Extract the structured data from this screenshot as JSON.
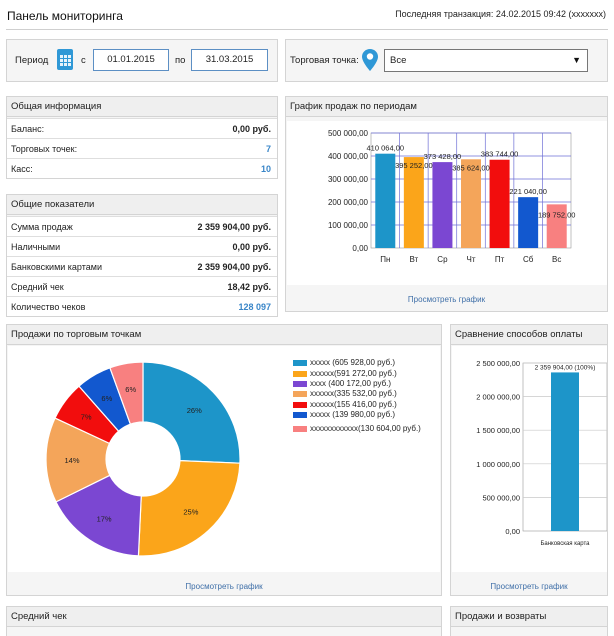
{
  "header": {
    "title": "Панель мониторинга",
    "last_transaction": "Последняя транзакция: 24.02.2015 09:42 (xxxxxxx)"
  },
  "filters": {
    "period_label": "Период",
    "from_label": "с",
    "from_value": "01.01.2015",
    "to_label": "по",
    "to_value": "31.03.2015",
    "store_label": "Торговая точка:",
    "store_value": "Все"
  },
  "general_info": {
    "title": "Общая информация",
    "rows": [
      {
        "label": "Баланс:",
        "value": "0,00 руб."
      },
      {
        "label": "Торговых точек:",
        "value": "7"
      },
      {
        "label": "Касс:",
        "value": "10"
      }
    ]
  },
  "general_metrics": {
    "title": "Общие показатели",
    "rows": [
      {
        "label": "Сумма продаж",
        "value": "2 359 904,00 руб."
      },
      {
        "label": "Наличными",
        "value": "0,00 руб."
      },
      {
        "label": "Банковскими картами",
        "value": "2 359 904,00 руб."
      },
      {
        "label": "Средний чек",
        "value": "18,42 руб."
      },
      {
        "label": "Количество чеков",
        "value": "128 097"
      }
    ]
  },
  "sales_by_period": {
    "title": "График продаж по периодам",
    "link": "Просмотреть график"
  },
  "sales_by_store": {
    "title": "Продажи по торговым точкам",
    "link": "Просмотреть график"
  },
  "payment_methods": {
    "title": "Сравнение способов оплаты",
    "link": "Просмотреть график"
  },
  "avg_check": {
    "title": "Средний чек"
  },
  "sales_returns": {
    "title": "Продажи и возвраты"
  },
  "chart_data": [
    {
      "type": "bar",
      "title": "",
      "categories": [
        "Пн",
        "Вт",
        "Ср",
        "Чт",
        "Пт",
        "Сб",
        "Вс"
      ],
      "values": [
        410064,
        395252,
        373428,
        385624,
        383744,
        221040,
        189752
      ],
      "labels": [
        "410 064,00",
        "395 252,00",
        "373 428,00",
        "385 624,00",
        "383 744,00",
        "221 040,00",
        "189 752,00"
      ],
      "colors": [
        "#1d95c9",
        "#fba51a",
        "#7b47d2",
        "#f4a55a",
        "#f20d0d",
        "#1258cf",
        "#f88080"
      ],
      "ylim": [
        0,
        500000
      ],
      "yticks": [
        "0,00",
        "100 000,00",
        "200 000,00",
        "300 000,00",
        "400 000,00",
        "500 000,00"
      ],
      "grid": true
    },
    {
      "type": "pie",
      "title": "",
      "series": [
        {
          "name": "xxxxx",
          "value": 605928,
          "label": "26%",
          "legend": "xxxxx  (605 928,00 руб.)",
          "color": "#1d95c9"
        },
        {
          "name": "xxxxxx",
          "value": 591272,
          "label": "25%",
          "legend": "xxxxxx(591 272,00 руб.)",
          "color": "#fba51a"
        },
        {
          "name": "xxxx",
          "value": 400172,
          "label": "17%",
          "legend": "xxxx   (400 172,00 руб.)",
          "color": "#7b47d2"
        },
        {
          "name": "xxxxxx",
          "value": 335532,
          "label": "14%",
          "legend": "xxxxxx(335 532,00 руб.)",
          "color": "#f4a55a"
        },
        {
          "name": "xxxxxx",
          "value": 155416,
          "label": "7%",
          "legend": "xxxxxx(155 416,00 руб.)",
          "color": "#f20d0d"
        },
        {
          "name": "xxxxx",
          "value": 139980,
          "label": "6%",
          "legend": "xxxxx  (139 980,00 руб.)",
          "color": "#1258cf"
        },
        {
          "name": "xxxxxxxxxxxx",
          "value": 130604,
          "label": "6%",
          "legend": "xxxxxxxxxxxx(130 604,00 руб.)",
          "color": "#f88080"
        }
      ]
    },
    {
      "type": "bar",
      "title": "",
      "categories": [
        "Банковская карта"
      ],
      "values": [
        2359904
      ],
      "labels": [
        "2 359 904,00 (100%)"
      ],
      "colors": [
        "#1d95c9"
      ],
      "ylim": [
        0,
        2500000
      ],
      "yticks": [
        "0,00",
        "500 000,00",
        "1 000 000,00",
        "1 500 000,00",
        "2 000 000,00",
        "2 500 000,00"
      ],
      "grid": true
    }
  ]
}
